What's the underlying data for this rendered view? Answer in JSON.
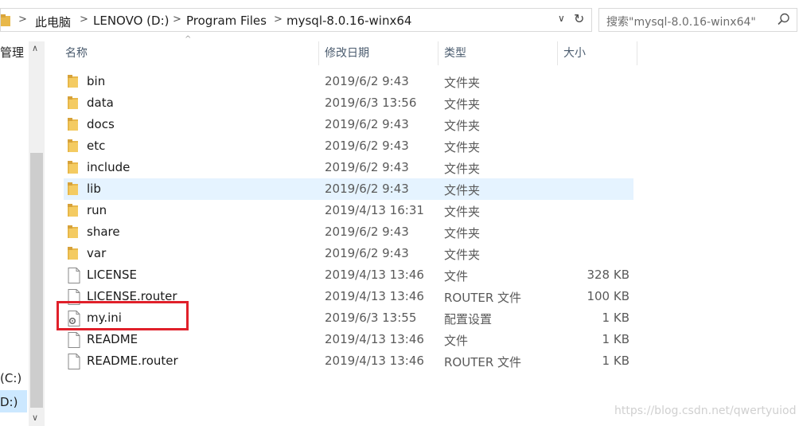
{
  "address_bar": {
    "crumbs": [
      "此电脑",
      "LENOVO (D:)",
      "Program Files",
      "mysql-8.0.16-winx64"
    ],
    "separator": ">",
    "dropdown_glyph": "∨",
    "refresh_glyph": "↻"
  },
  "search": {
    "placeholder": "搜索\"mysql-8.0.16-winx64\""
  },
  "nav_pane": {
    "partial_label": "管理",
    "drive_c": "(C:)",
    "drive_d": "D:)"
  },
  "columns": {
    "name": "名称",
    "date": "修改日期",
    "type": "类型",
    "size": "大小"
  },
  "files": [
    {
      "name": "bin",
      "date": "2019/6/2 9:43",
      "type": "文件夹",
      "size": "",
      "icon": "folder-icon"
    },
    {
      "name": "data",
      "date": "2019/6/3 13:56",
      "type": "文件夹",
      "size": "",
      "icon": "folder-icon"
    },
    {
      "name": "docs",
      "date": "2019/6/2 9:43",
      "type": "文件夹",
      "size": "",
      "icon": "folder-icon"
    },
    {
      "name": "etc",
      "date": "2019/6/2 9:43",
      "type": "文件夹",
      "size": "",
      "icon": "folder-icon"
    },
    {
      "name": "include",
      "date": "2019/6/2 9:43",
      "type": "文件夹",
      "size": "",
      "icon": "folder-icon"
    },
    {
      "name": "lib",
      "date": "2019/6/2 9:43",
      "type": "文件夹",
      "size": "",
      "icon": "folder-icon"
    },
    {
      "name": "run",
      "date": "2019/4/13 16:31",
      "type": "文件夹",
      "size": "",
      "icon": "folder-icon"
    },
    {
      "name": "share",
      "date": "2019/6/2 9:43",
      "type": "文件夹",
      "size": "",
      "icon": "folder-icon"
    },
    {
      "name": "var",
      "date": "2019/6/2 9:43",
      "type": "文件夹",
      "size": "",
      "icon": "folder-icon"
    },
    {
      "name": "LICENSE",
      "date": "2019/4/13 13:46",
      "type": "文件",
      "size": "328 KB",
      "icon": "file-icon"
    },
    {
      "name": "LICENSE.router",
      "date": "2019/4/13 13:46",
      "type": "ROUTER 文件",
      "size": "100 KB",
      "icon": "file-icon"
    },
    {
      "name": "my.ini",
      "date": "2019/6/3 13:55",
      "type": "配置设置",
      "size": "1 KB",
      "icon": "settings-file-icon"
    },
    {
      "name": "README",
      "date": "2019/4/13 13:46",
      "type": "文件",
      "size": "1 KB",
      "icon": "file-icon"
    },
    {
      "name": "README.router",
      "date": "2019/4/13 13:46",
      "type": "ROUTER 文件",
      "size": "1 KB",
      "icon": "file-icon"
    }
  ],
  "hovered_row": 5,
  "highlighted_row": 11,
  "watermark": "https://blog.csdn.net/qwertyuiod",
  "colors": {
    "hover": "#e5f3ff",
    "highlight_box": "#e0202a",
    "folder": "#e8b84a"
  }
}
